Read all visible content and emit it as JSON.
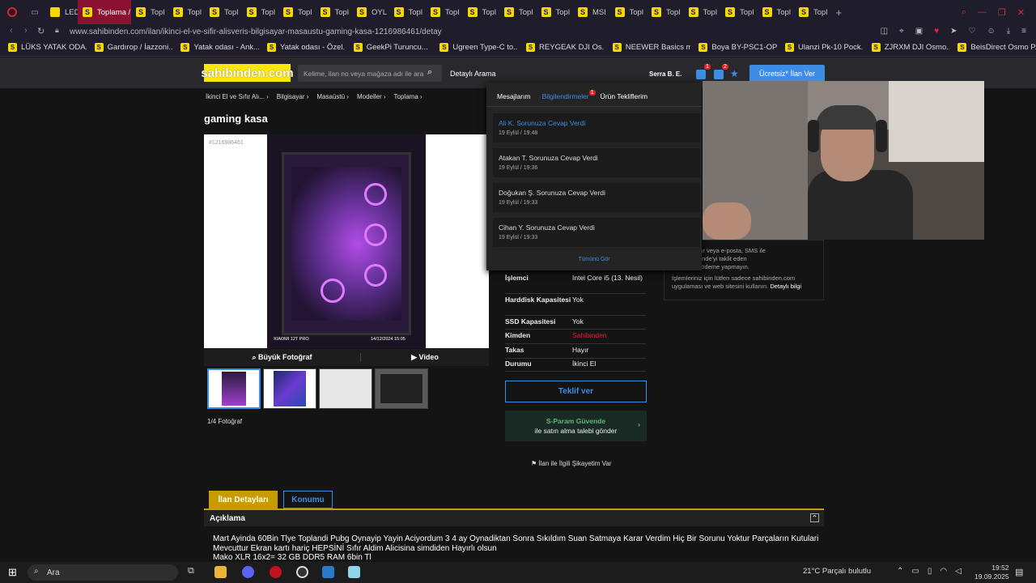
{
  "browser": {
    "tabs": [
      {
        "label": "LED",
        "active": false
      },
      {
        "label": "Toplama /",
        "active": true
      },
      {
        "label": "Topl",
        "active": false
      },
      {
        "label": "Topl",
        "active": false
      },
      {
        "label": "Topl",
        "active": false
      },
      {
        "label": "Topl",
        "active": false
      },
      {
        "label": "Topl",
        "active": false
      },
      {
        "label": "Topl",
        "active": false
      },
      {
        "label": "OYL",
        "active": false
      },
      {
        "label": "Topl",
        "active": false
      },
      {
        "label": "Topl",
        "active": false
      },
      {
        "label": "Topl",
        "active": false
      },
      {
        "label": "Topl",
        "active": false
      },
      {
        "label": "Topl",
        "active": false
      },
      {
        "label": "MSI",
        "active": false
      },
      {
        "label": "Topl",
        "active": false
      },
      {
        "label": "Topl",
        "active": false
      },
      {
        "label": "Topl",
        "active": false
      },
      {
        "label": "Topl",
        "active": false
      },
      {
        "label": "Topl",
        "active": false
      },
      {
        "label": "Topl",
        "active": false
      }
    ],
    "new_tab": "+",
    "url": "www.sahibinden.com/ilan/ikinci-el-ve-sifir-alisveris-bilgisayar-masaustu-gaming-kasa-1216986461/detay",
    "bookmarks": [
      "LÜKS YATAK ODA...",
      "Gardırop / İazzoni...",
      "Yatak odası - Ank...",
      "Yatak odası - Özel...",
      "GeekPi Turuncu...",
      "Ugreen Type-C to...",
      "REYGEAK DJI Os...",
      "NEEWER Basics m...",
      "Boya BY-PSC1-OP...",
      "Ulanzi Pk-10 Pock...",
      "ZJRXM DJI Osmo...",
      "BeisDirect Osmo P..."
    ]
  },
  "site": {
    "logo": "sahibinden.com",
    "search_placeholder": "Kelime, ilan no veya mağaza adı ile ara",
    "advanced_search": "Detaylı Arama",
    "user": "Serra B. E.",
    "badge1": "1",
    "badge2": "2",
    "post_ad": "Ücretsiz* İlan Ver"
  },
  "breadcrumb": [
    "İkinci El ve Sıfır Alı... ›",
    "Bilgisayar ›",
    "Masaüstü ›",
    "Modeller ›",
    "Toplama ›"
  ],
  "listing": {
    "title": "gaming kasa",
    "ad_no": "#1216986461",
    "photo_caption_left": "XIAOMI 12T PRO",
    "photo_caption_right": "14/12/2024  15:05",
    "big_photo": "Büyük Fotoğraf",
    "video": "Video",
    "photo_count": "1/4 Fotoğraf",
    "specs": [
      {
        "k": "İşlemci",
        "v": "Intel Core i5 (13. Nesil)",
        "red": false
      },
      {
        "k": "Harddisk Kapasitesi",
        "v": "Yok",
        "red": false
      },
      {
        "k": "SSD Kapasitesi",
        "v": "Yok",
        "red": false
      },
      {
        "k": "Kimden",
        "v": "Sahibinden",
        "red": true
      },
      {
        "k": "Takas",
        "v": "Hayır",
        "red": false
      },
      {
        "k": "Durumu",
        "v": "İkinci El",
        "red": false
      }
    ],
    "offer_button": "Teklif ver",
    "sparam_title": "S-Param Güvende",
    "sparam_sub": "ile satın alma talebi gönder",
    "complaint": "İlan ile İlgili Şikayetim Var"
  },
  "notice": {
    "line1": "uygulamalar veya e-posta, SMS ile",
    "line2": "aram Güvende'yi taklit eden",
    "line3": "tıklayıp bir ödeme yapmayın.",
    "line4": "İşlemleriniz için lütfen sadece sahibinden.com",
    "line5": "uygulaması ve web sitesini kullanın.",
    "link": "Detaylı bilgi"
  },
  "dropdown": {
    "tabs": [
      "Mesajlarım",
      "Bilgilendirmeler",
      "Ürün Tekliflerim"
    ],
    "tab_badge": "1",
    "notifications": [
      {
        "title": "Ali K. Sorunuza Cevap Verdi",
        "time": "19 Eylül / 19:48",
        "unread": true
      },
      {
        "title": "Atakan T. Sorunuza Cevap Verdi",
        "time": "19 Eylül / 19:36",
        "unread": false
      },
      {
        "title": "Doğukan Ş. Sorunuza Cevap Verdi",
        "time": "19 Eylül / 19:33",
        "unread": false
      },
      {
        "title": "Cihan Y. Sorunuza Cevap Verdi",
        "time": "19 Eylül / 19:33",
        "unread": false
      }
    ],
    "see_all": "Tümünü Gör"
  },
  "detail_tabs": [
    "İlan Detayları",
    "Konumu"
  ],
  "description": {
    "heading": "Açıklama",
    "text1": "Mart Ayinda 60Bin Tlye Toplandi Pubg Oynayip Yayin Aciyordum 3 4 ay Oynadiktan Sonra Sıkıldım Suan Satmaya Karar Verdim Hiç Bir Sorunu Yoktur Parçaların Kutulari",
    "text2": "Mevcuttur Ekran kartı hariç HEPSİNİ Sıfır Aldim Alicisina simdiden Hayırlı olsun",
    "text3": "Mako XLR 16x2= 32 GB DDR5 RAM 6bin Tl"
  },
  "taskbar": {
    "search": "Ara",
    "weather": "21°C  Parçalı bulutlu",
    "time": "19:52",
    "date": "19.09.2025"
  },
  "colors": {
    "accent": "#3d8de5",
    "brand_yellow": "#ffe800",
    "tab_active": "#8a1230",
    "gold": "#c89b00"
  }
}
